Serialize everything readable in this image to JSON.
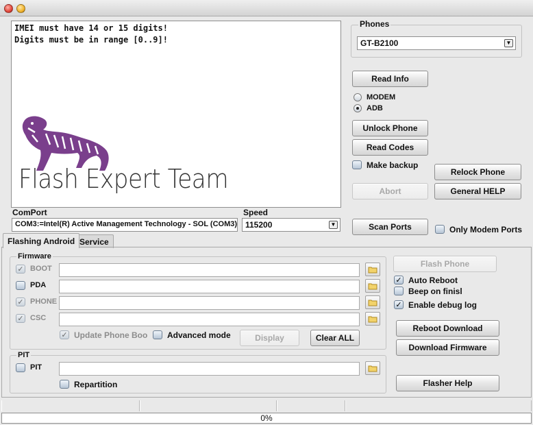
{
  "log": {
    "lines": [
      "IMEI must have 14 or 15 digits!",
      "Digits must be in range [0..9]!"
    ],
    "logo_text": "Flash Expert Team"
  },
  "phones": {
    "label": "Phones",
    "selected": "GT-B2100"
  },
  "buttons": {
    "read_info": "Read Info",
    "unlock_phone": "Unlock Phone",
    "read_codes": "Read Codes",
    "relock_phone": "Relock Phone",
    "abort": "Abort",
    "general_help": "General HELP",
    "scan_ports": "Scan Ports",
    "flash_phone": "Flash Phone",
    "reboot_download": "Reboot Download",
    "download_firmware": "Download Firmware",
    "flasher_help": "Flasher Help",
    "display": "Display",
    "clear_all": "Clear ALL"
  },
  "mode": {
    "modem": "MODEM",
    "adb": "ADB",
    "selected": "ADB"
  },
  "options": {
    "make_backup": "Make backup",
    "only_modem_ports": "Only Modem Ports",
    "auto_reboot": "Auto Reboot",
    "beep_on_finish": "Beep on finisl",
    "enable_debug_log": "Enable debug log",
    "update_phone_boot": "Update Phone Boot",
    "advanced_mode": "Advanced mode",
    "repartition": "Repartition"
  },
  "comport": {
    "label": "ComPort",
    "value": "COM3:=Intel(R) Active Management Technology - SOL (COM3)"
  },
  "speed": {
    "label": "Speed",
    "value": "115200"
  },
  "tabs": [
    {
      "label": "Flashing Android"
    },
    {
      "label": "Service"
    }
  ],
  "firmware": {
    "group_label": "Firmware",
    "rows": [
      {
        "label": "BOOT",
        "checked": true,
        "disabled": true
      },
      {
        "label": "PDA",
        "checked": false,
        "disabled": false
      },
      {
        "label": "PHONE",
        "checked": true,
        "disabled": true
      },
      {
        "label": "CSC",
        "checked": true,
        "disabled": true
      }
    ]
  },
  "pit": {
    "group_label": "PIT",
    "row_label": "PIT"
  },
  "progress": {
    "text": "0%",
    "value": 0
  }
}
